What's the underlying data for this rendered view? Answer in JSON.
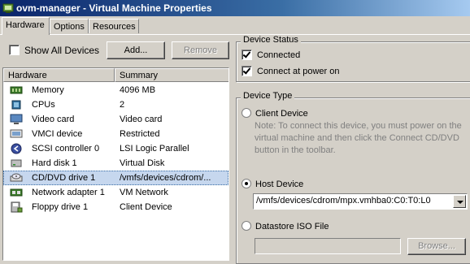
{
  "window": {
    "title": "ovm-manager - Virtual Machine Properties"
  },
  "tabs": [
    {
      "label": "Hardware",
      "active": true
    },
    {
      "label": "Options",
      "active": false
    },
    {
      "label": "Resources",
      "active": false
    }
  ],
  "toolbar": {
    "show_all_devices_label": "Show All Devices",
    "show_all_devices_checked": false,
    "add_label": "Add...",
    "remove_label": "Remove"
  },
  "hardware_list": {
    "columns": [
      "Hardware",
      "Summary"
    ],
    "rows": [
      {
        "icon": "memory-icon",
        "name": "Memory",
        "summary": "4096 MB",
        "selected": false
      },
      {
        "icon": "cpu-icon",
        "name": "CPUs",
        "summary": "2",
        "selected": false
      },
      {
        "icon": "monitor-icon",
        "name": "Video card",
        "summary": "Video card",
        "selected": false
      },
      {
        "icon": "vmci-icon",
        "name": "VMCI device",
        "summary": "Restricted",
        "selected": false
      },
      {
        "icon": "scsi-icon",
        "name": "SCSI controller 0",
        "summary": "LSI Logic Parallel",
        "selected": false
      },
      {
        "icon": "disk-icon",
        "name": "Hard disk 1",
        "summary": "Virtual Disk",
        "selected": false
      },
      {
        "icon": "cdrom-icon",
        "name": "CD/DVD drive 1",
        "summary": "/vmfs/devices/cdrom/...",
        "selected": true
      },
      {
        "icon": "network-icon",
        "name": "Network adapter 1",
        "summary": "VM Network",
        "selected": false
      },
      {
        "icon": "floppy-icon",
        "name": "Floppy drive 1",
        "summary": "Client Device",
        "selected": false
      }
    ]
  },
  "device_status": {
    "title": "Device Status",
    "connected_label": "Connected",
    "connected_checked": true,
    "connect_power_on_label": "Connect at power on",
    "connect_power_on_checked": true
  },
  "device_type": {
    "title": "Device Type",
    "client_device_label": "Client Device",
    "client_device_note": "Note: To connect this device, you must power on the virtual machine and then click the Connect CD/DVD button in the toolbar.",
    "host_device_label": "Host Device",
    "host_device_value": "/vmfs/devices/cdrom/mpx.vmhba0:C0:T0:L0",
    "datastore_iso_label": "Datastore ISO File",
    "datastore_iso_value": "",
    "browse_label": "Browse...",
    "selected": "host_device"
  }
}
